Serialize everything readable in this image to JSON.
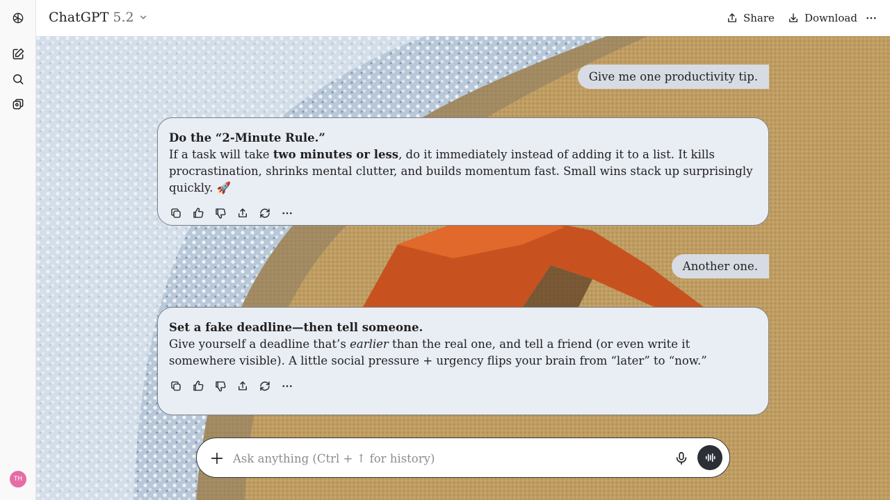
{
  "header": {
    "model_name": "ChatGPT",
    "model_version": "5.2",
    "share_label": "Share",
    "download_label": "Download"
  },
  "sidebar": {
    "avatar_initials": "TH"
  },
  "messages": [
    {
      "role": "user",
      "text": "Give me one productivity tip."
    },
    {
      "role": "assistant",
      "title": "Do the “2-Minute Rule.”",
      "pre": "If a task will take ",
      "bold": "two minutes or less",
      "post": ", do it immediately instead of adding it to a list. It kills procrastination, shrinks mental clutter, and builds momentum fast. Small wins stack up surprisingly quickly. ",
      "emoji": "🚀"
    },
    {
      "role": "user",
      "text": "Another one."
    },
    {
      "role": "assistant",
      "title": "Set a fake deadline—then tell someone.",
      "pre": "Give yourself a deadline that’s ",
      "italic": "earlier",
      "post": " than the real one, and tell a friend (or even write it somewhere visible). A little social pressure + urgency flips your brain from “later” to “now.”"
    }
  ],
  "composer": {
    "placeholder": "Ask anything (Ctrl + ↑ for history)"
  },
  "icons": {
    "logo": "openai-logo-icon",
    "new_chat": "new-chat-icon",
    "search": "search-icon",
    "library": "library-icon",
    "share": "share-icon",
    "download": "download-icon",
    "more": "more-icon",
    "copy": "copy-icon",
    "thumbs_up": "thumbs-up-icon",
    "thumbs_down": "thumbs-down-icon",
    "regenerate": "regenerate-icon",
    "mic": "mic-icon",
    "voice": "voice-mode-icon",
    "plus": "plus-icon"
  }
}
